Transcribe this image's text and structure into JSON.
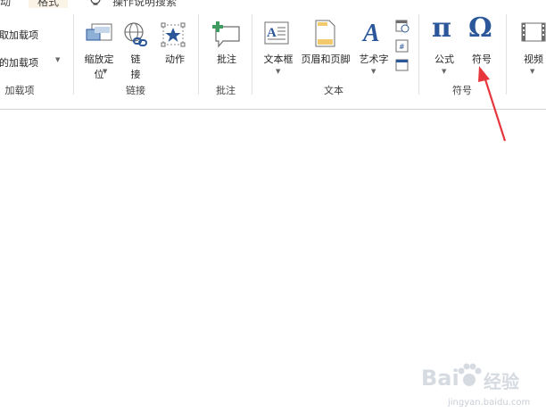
{
  "tabs": {
    "left_fragment": "动",
    "active_tab": "格式",
    "tell_me": "操作说明搜索"
  },
  "addins": {
    "item1": "获取加载项",
    "item2": "我的加载项",
    "group_label": "加载项"
  },
  "links": {
    "zoom_label_line1": "缩放定",
    "zoom_label_line2": "位",
    "link_label_line1": "链",
    "link_label_line2": "接",
    "action_label": "动作",
    "group_label": "链接"
  },
  "comments": {
    "comment_label": "批注",
    "group_label": "批注"
  },
  "text": {
    "textbox_label": "文本框",
    "header_footer_label": "页眉和页脚",
    "wordart_label": "艺术字",
    "group_label": "文本"
  },
  "symbols": {
    "equation_glyph": "π",
    "equation_label": "公式",
    "symbol_glyph": "Ω",
    "symbol_label": "符号",
    "group_label": "符号"
  },
  "media": {
    "video_label": "视频"
  },
  "watermark": {
    "brand": "Bai",
    "brand2": "经验",
    "url": "jingyan.baidu.com"
  },
  "colors": {
    "accent_blue": "#2b579a",
    "annotation_red": "#e8363d",
    "active_tab_bg": "#fbf3e6"
  }
}
